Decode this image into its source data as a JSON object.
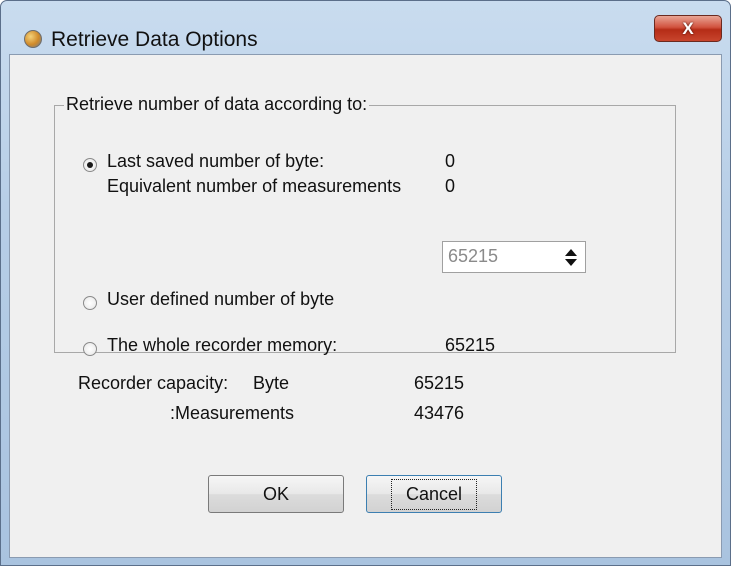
{
  "window": {
    "title": "Retrieve Data Options",
    "close_label": "X"
  },
  "group": {
    "legend": "Retrieve number of data according to:",
    "options": {
      "last_saved": {
        "label": "Last saved number of byte:",
        "value": "0",
        "checked": true,
        "sub_label": "Equivalent number of measurements",
        "sub_value": "0"
      },
      "user_defined": {
        "label": "User defined number of byte",
        "input_value": "65215",
        "checked": false
      },
      "whole_memory": {
        "label": "The whole recorder memory:",
        "value": "65215",
        "checked": false
      }
    }
  },
  "capacity": {
    "label": "Recorder capacity:",
    "byte_label": "Byte",
    "byte_value": "65215",
    "measurements_label": ":Measurements",
    "measurements_value": "43476"
  },
  "buttons": {
    "ok": "OK",
    "cancel": "Cancel"
  },
  "icons": {
    "app": "app-globe-icon",
    "close": "close-icon",
    "spin_up": "spin-up-icon",
    "spin_down": "spin-down-icon"
  }
}
